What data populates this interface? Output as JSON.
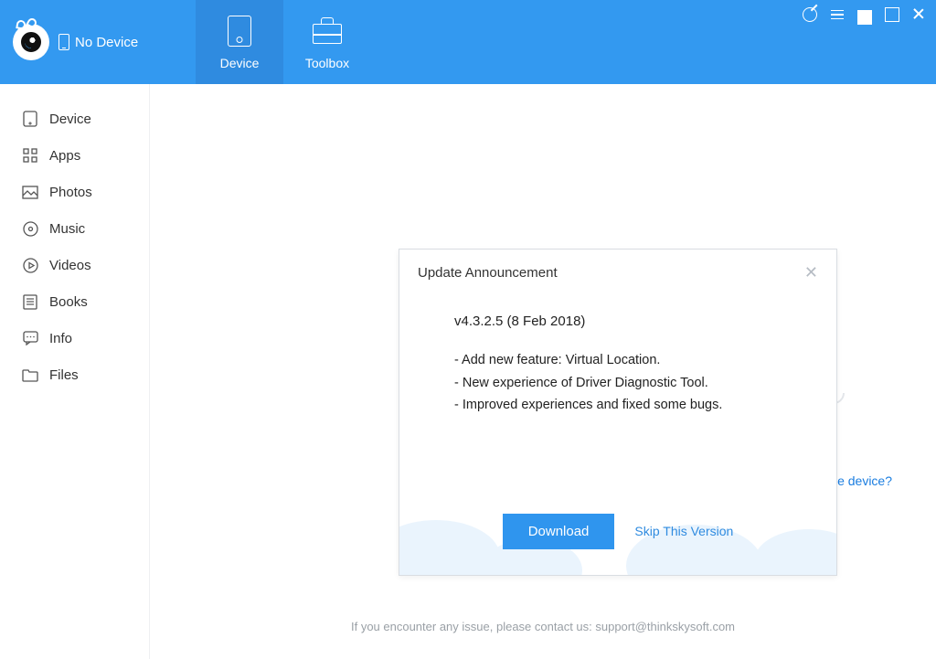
{
  "header": {
    "device_status": "No Device",
    "tabs": [
      {
        "label": "Device",
        "active": true
      },
      {
        "label": "Toolbox",
        "active": false
      }
    ]
  },
  "sidebar": {
    "items": [
      {
        "icon": "device-icon",
        "label": "Device"
      },
      {
        "icon": "apps-icon",
        "label": "Apps"
      },
      {
        "icon": "photos-icon",
        "label": "Photos"
      },
      {
        "icon": "music-icon",
        "label": "Music"
      },
      {
        "icon": "videos-icon",
        "label": "Videos"
      },
      {
        "icon": "books-icon",
        "label": "Books"
      },
      {
        "icon": "info-icon",
        "label": "Info"
      },
      {
        "icon": "files-icon",
        "label": "Files"
      }
    ]
  },
  "main": {
    "help_link": "Cannot recognize the device?",
    "footer": "If you encounter any issue, please contact us: support@thinkskysoft.com"
  },
  "modal": {
    "title": "Update Announcement",
    "version": "v4.3.2.5 (8 Feb 2018)",
    "notes": [
      "- Add new feature: Virtual Location.",
      "- New experience of Driver Diagnostic Tool.",
      "- Improved experiences and fixed some bugs."
    ],
    "download_label": "Download",
    "skip_label": "Skip This Version"
  }
}
